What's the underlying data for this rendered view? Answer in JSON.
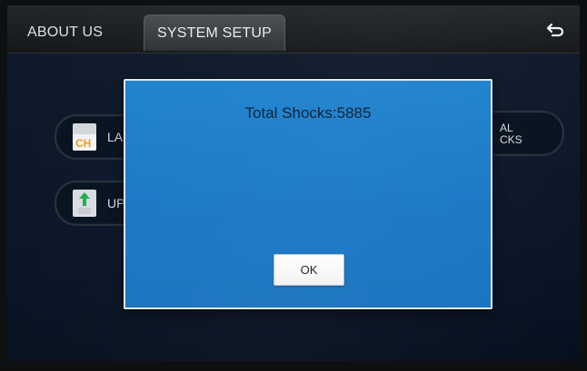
{
  "header": {
    "tabs": [
      {
        "label": "ABOUT US"
      },
      {
        "label": "SYSTEM SETUP"
      }
    ],
    "back_icon": "back-arrow-icon"
  },
  "background": {
    "buttons": [
      {
        "icon": "language-icon",
        "icon_text": "CH",
        "label_visible": "LA"
      },
      {
        "icon": "update-icon",
        "label_visible": "UP"
      },
      {
        "label_visible": "AL\nCKS"
      }
    ]
  },
  "dialog": {
    "title": "Total Shocks:5885",
    "ok_label": "OK"
  },
  "colors": {
    "dialog_blue": "#1f82ce",
    "background_navy": "#0a1628"
  }
}
